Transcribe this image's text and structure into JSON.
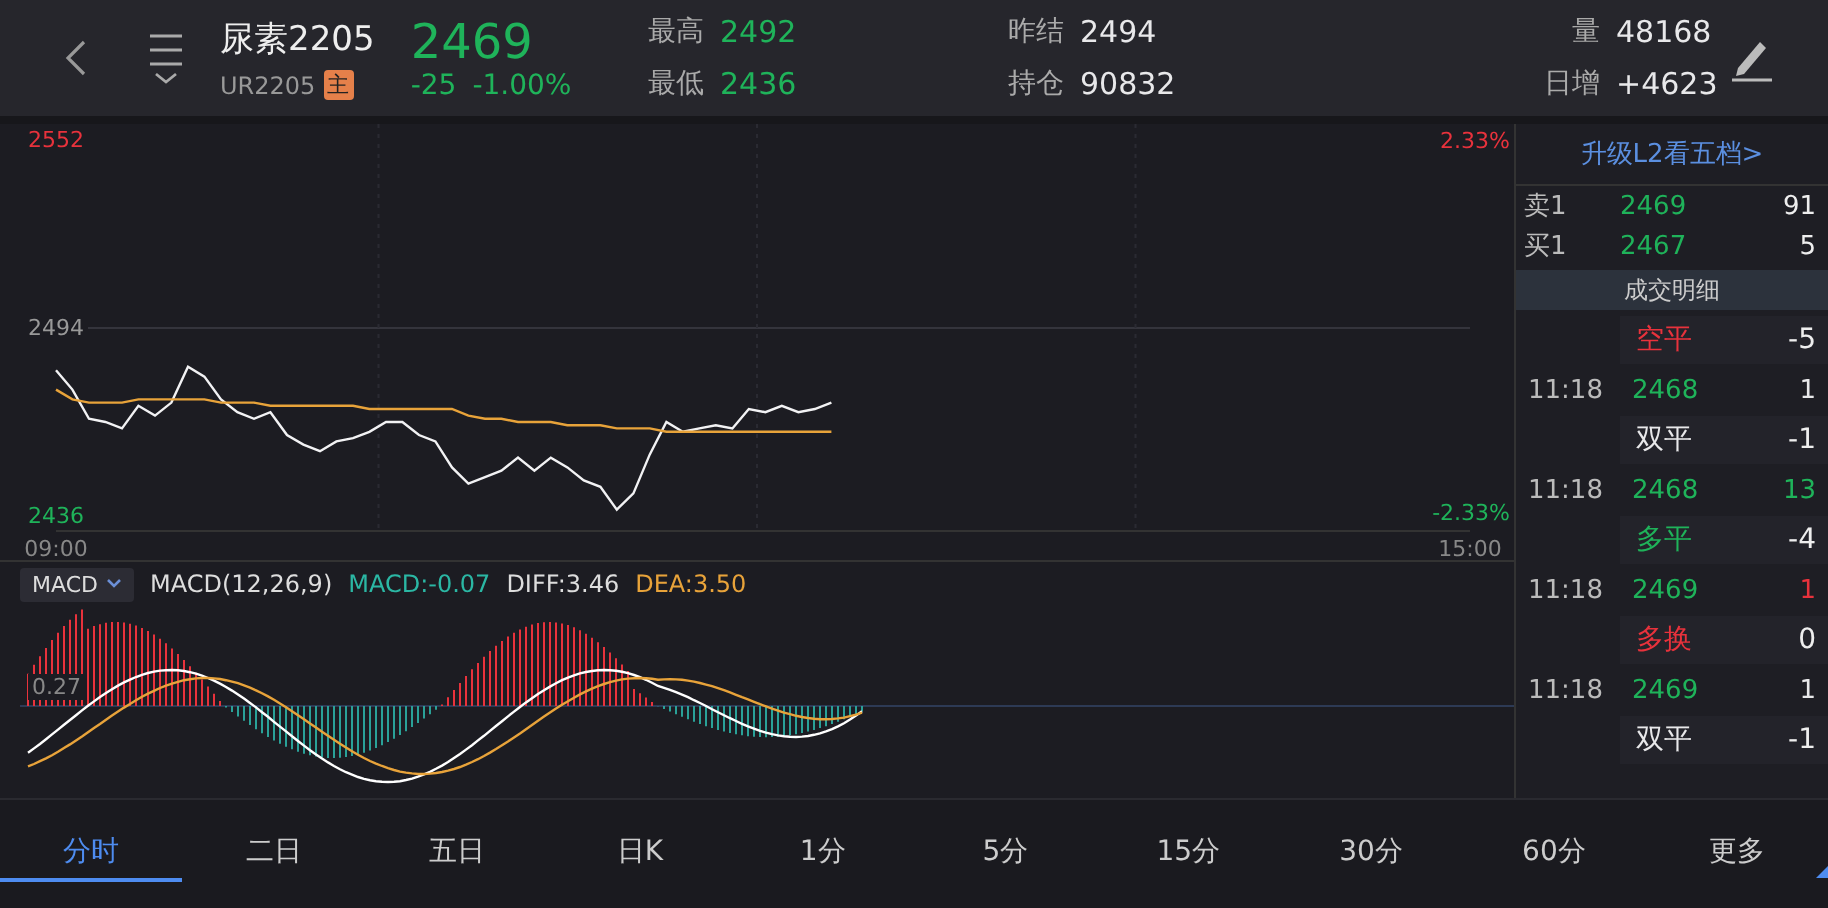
{
  "header": {
    "name": "尿素2205",
    "code": "UR2205",
    "badge": "主",
    "price": "2469",
    "change": "-25",
    "change_pct": "-1.00%",
    "stats": [
      {
        "label": "最高",
        "value": "2492",
        "color": "#1fb35a"
      },
      {
        "label": "昨结",
        "value": "2494",
        "color": "#e8e8ea"
      },
      {
        "label": "量",
        "value": "48168",
        "color": "#e8e8ea"
      },
      {
        "label": "最低",
        "value": "2436",
        "color": "#1fb35a"
      },
      {
        "label": "持仓",
        "value": "90832",
        "color": "#e8e8ea"
      },
      {
        "label": "日增",
        "value": "+4623",
        "color": "#e8e8ea"
      }
    ]
  },
  "price_chart": {
    "top_pct": "2.33%",
    "bottom_pct": "-2.33%",
    "chart_data": {
      "type": "line",
      "x": [
        9,
        9.07,
        9.14,
        9.21,
        9.28,
        9.35,
        9.42,
        9.49,
        9.56,
        9.63,
        9.7,
        9.77,
        9.84,
        9.91,
        9.98,
        10.05,
        10.12,
        10.19,
        10.26,
        10.33,
        10.4,
        10.47,
        10.54,
        10.61,
        10.68,
        10.75,
        10.82,
        10.89,
        10.96,
        11.03,
        11.1,
        11.17,
        11.24,
        11.31,
        11.38,
        11.45,
        11.52,
        11.59,
        11.66,
        11.73,
        11.8,
        11.87,
        11.94,
        12.01,
        12.08,
        12.15,
        12.22,
        12.29
      ],
      "xlim": [
        9,
        15
      ],
      "ylim": [
        2436,
        2552
      ],
      "yticks": [
        2436,
        2494,
        2552
      ],
      "xticks": [
        {
          "value": 9,
          "label": "09:00"
        },
        {
          "value": 15,
          "label": "15:00"
        }
      ],
      "series": [
        {
          "color": "#f2f2f4",
          "values": [
            2481,
            2475,
            2466,
            2465,
            2463,
            2470,
            2467,
            2471,
            2482,
            2479,
            2472,
            2468,
            2466,
            2468,
            2461,
            2458,
            2456,
            2459,
            2460,
            2462,
            2465,
            2465,
            2461,
            2459,
            2451,
            2446,
            2448,
            2450,
            2454,
            2450,
            2454,
            2451,
            2447,
            2445,
            2438,
            2443,
            2455,
            2465,
            2462,
            2463,
            2464,
            2463,
            2469,
            2468,
            2470,
            2468,
            2469,
            2471
          ]
        },
        {
          "color": "#e8a33a",
          "values": [
            2475,
            2472,
            2471,
            2471,
            2471,
            2472,
            2472,
            2472,
            2472,
            2472,
            2471,
            2471,
            2471,
            2470,
            2470,
            2470,
            2470,
            2470,
            2470,
            2469,
            2469,
            2469,
            2469,
            2469,
            2469,
            2467,
            2466,
            2466,
            2465,
            2465,
            2465,
            2464,
            2464,
            2464,
            2463,
            2463,
            2463,
            2462,
            2462,
            2462,
            2462,
            2462,
            2462,
            2462,
            2462,
            2462,
            2462,
            2462
          ]
        }
      ]
    }
  },
  "macd": {
    "selector": "MACD",
    "params": "MACD(12,26,9)",
    "macd": "MACD:-0.07",
    "diff": "DIFF:3.46",
    "dea": "DEA:3.50",
    "zero_label": "0.27"
  },
  "order_book": {
    "upgrade": "升级L2看五档>",
    "levels": [
      {
        "label": "卖1",
        "price": "2469",
        "volume": "91"
      },
      {
        "label": "买1",
        "price": "2467",
        "volume": "5"
      }
    ],
    "trades_title": "成交明细",
    "trades": [
      {
        "action": {
          "text": "空平",
          "color": "#e8323c"
        },
        "change": "-5"
      },
      {
        "time": "11:18",
        "price": "2468",
        "volume": {
          "text": "1",
          "color": "#e8e8ea"
        },
        "action": {
          "text": "双平",
          "color": "#e8e8ea"
        },
        "change": "-1"
      },
      {
        "time": "11:18",
        "price": "2468",
        "volume": {
          "text": "13",
          "color": "#1fb35a"
        },
        "action": {
          "text": "多平",
          "color": "#1fb35a"
        },
        "change": "-4"
      },
      {
        "time": "11:18",
        "price": "2469",
        "volume": {
          "text": "1",
          "color": "#e8323c"
        },
        "action": {
          "text": "多换",
          "color": "#e8323c"
        },
        "change": "0"
      },
      {
        "time": "11:18",
        "price": "2469",
        "volume": {
          "text": "1",
          "color": "#e8e8ea"
        },
        "action": {
          "text": "双平",
          "color": "#e8e8ea"
        },
        "change": "-1"
      }
    ]
  },
  "tabs": [
    {
      "label": "分时",
      "selected": true
    },
    {
      "label": "二日",
      "selected": false
    },
    {
      "label": "五日",
      "selected": false
    },
    {
      "label": "日K",
      "selected": false
    },
    {
      "label": "1分",
      "selected": false
    },
    {
      "label": "5分",
      "selected": false
    },
    {
      "label": "15分",
      "selected": false
    },
    {
      "label": "30分",
      "selected": false
    },
    {
      "label": "60分",
      "selected": false
    },
    {
      "label": "更多",
      "selected": false,
      "kind": "more"
    }
  ]
}
